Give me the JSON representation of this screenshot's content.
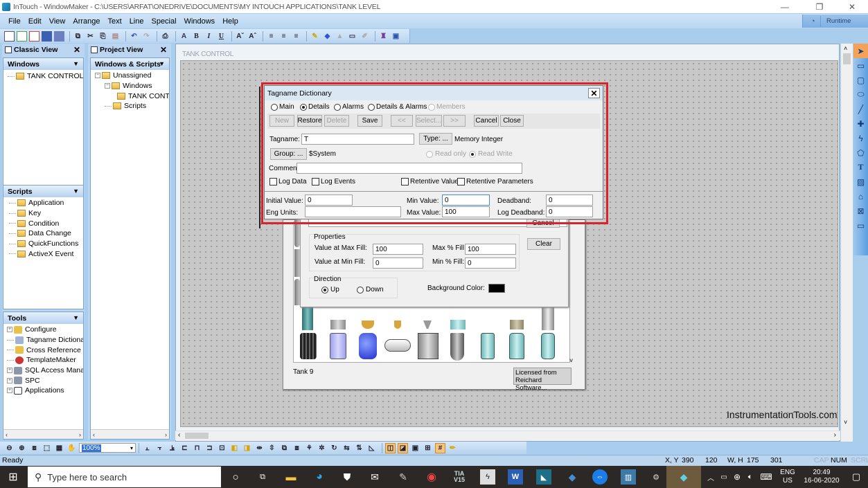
{
  "window": {
    "title": "InTouch - WindowMaker - C:\\USERS\\ARFAT\\ONEDRIVE\\DOCUMENTS\\MY INTOUCH APPLICATIONS\\TANK LEVEL",
    "minimize": "—",
    "restore": "❐",
    "close": "✕"
  },
  "menu": [
    "File",
    "Edit",
    "View",
    "Arrange",
    "Text",
    "Line",
    "Special",
    "Windows",
    "Help"
  ],
  "runtime_label": "Runtime",
  "toolbar_text": {
    "bold": "B",
    "italic": "I",
    "underline": "U"
  },
  "classic_view": {
    "title": "Classic View",
    "windows_header": "Windows",
    "windows_items": [
      "TANK CONTROL"
    ],
    "scripts_header": "Scripts",
    "scripts_items": [
      "Application",
      "Key",
      "Condition",
      "Data Change",
      "QuickFunctions",
      "ActiveX Event"
    ],
    "tools_header": "Tools",
    "tools_items": [
      "Configure",
      "Tagname Dictionary",
      "Cross Reference",
      "TemplateMaker",
      "SQL Access Manager",
      "SPC",
      "Applications"
    ]
  },
  "project_view": {
    "title": "Project View",
    "header": "Windows & Scripts",
    "tree": [
      "Unassigned",
      "Windows",
      "TANK CONTROL",
      "Scripts"
    ]
  },
  "canvas": {
    "window_name": "TANK CONTROL",
    "watermark": "InstrumentationTools.com"
  },
  "wizard": {
    "properties_label": "Properties",
    "value_max_fill_label": "Value at Max Fill:",
    "value_max_fill": "100",
    "value_min_fill_label": "Value at Min Fill:",
    "value_min_fill": "0",
    "max_pct_fill_label": "Max % Fill:",
    "max_pct_fill": "100",
    "min_pct_fill_label": "Min % Fill:",
    "min_pct_fill": "0",
    "clear_label": "Clear",
    "cancel_label": "Cancel",
    "direction_label": "Direction",
    "up_label": "Up",
    "down_label": "Down",
    "direction_selected": "Up",
    "bg_color_label": "Background Color:",
    "bg_color": "#000000",
    "selected_tank": "Tank 9",
    "license_line1": "Licensed from",
    "license_line2": "Reichard Software..."
  },
  "tag_dictionary": {
    "title": "Tagname Dictionary",
    "modes": [
      {
        "label": "Main",
        "selected": false,
        "disabled": false
      },
      {
        "label": "Details",
        "selected": true,
        "disabled": false
      },
      {
        "label": "Alarms",
        "selected": false,
        "disabled": false
      },
      {
        "label": "Details & Alarms",
        "selected": false,
        "disabled": false
      },
      {
        "label": "Members",
        "selected": false,
        "disabled": true
      }
    ],
    "buttons": {
      "new": "New",
      "restore": "Restore",
      "delete": "Delete",
      "save": "Save",
      "prev": "<<",
      "select": "Select...",
      "next": ">>",
      "cancel": "Cancel",
      "close": "Close"
    },
    "tagname_label": "Tagname:",
    "tagname": "T",
    "type_button": "Type: ...",
    "type_value": "Memory Integer",
    "group_button": "Group: ...",
    "group_value": "$System",
    "read_only_label": "Read only",
    "read_write_label": "Read Write",
    "comment_label": "Comment:",
    "comment": "",
    "log_data_label": "Log Data",
    "log_events_label": "Log Events",
    "retentive_value_label": "Retentive Value",
    "retentive_params_label": "Retentive Parameters",
    "initial_value_label": "Initial Value:",
    "initial_value": "0",
    "eng_units_label": "Eng Units:",
    "eng_units": "",
    "min_value_label": "Min Value:",
    "min_value": "0",
    "max_value_label": "Max Value:",
    "max_value": "100",
    "deadband_label": "Deadband:",
    "deadband": "0",
    "log_deadband_label": "Log Deadband:",
    "log_deadband": "0"
  },
  "zoom_value": "100%",
  "status": {
    "text": "Ready",
    "xy_label": "X, Y",
    "x": "390",
    "y": "120",
    "wh_label": "W, H",
    "w": "175",
    "h": "301",
    "cap": "CAP",
    "num": "NUM",
    "scrl": "SCRL"
  },
  "taskbar": {
    "search_placeholder": "Type here to search",
    "tia_label": "TIA V15",
    "lang1": "ENG",
    "lang2": "US",
    "time": "20:49",
    "date": "16-06-2020"
  }
}
